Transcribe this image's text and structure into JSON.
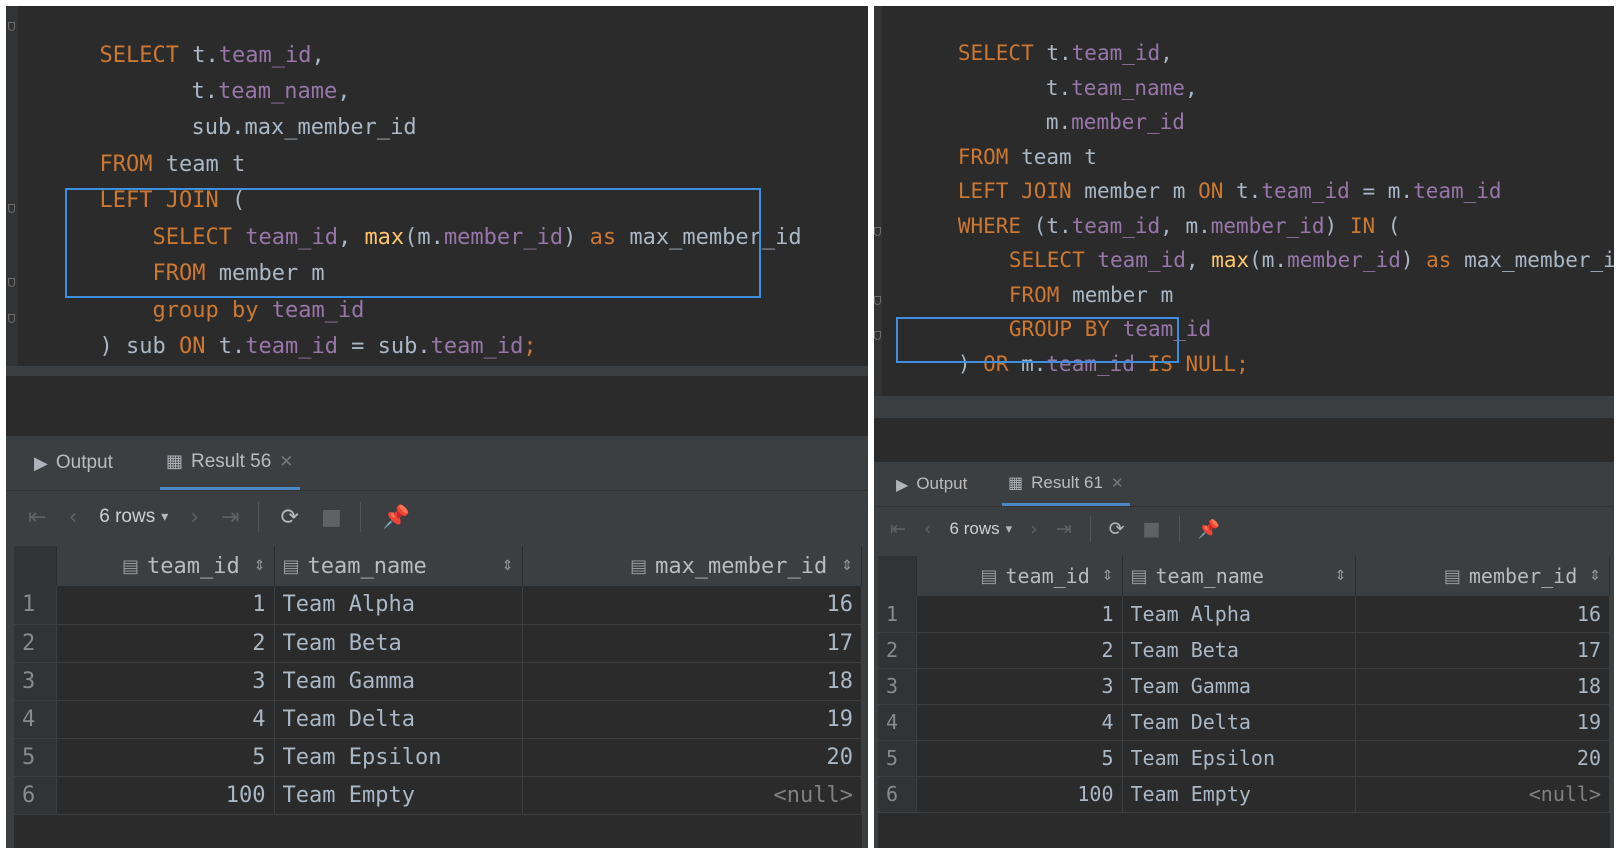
{
  "colors": {
    "keyword": "#cc7832",
    "field": "#9876aa",
    "function": "#ffc66d",
    "text": "#a9b7c6",
    "highlight": "#3d8fe0"
  },
  "left": {
    "code": {
      "l1": [
        "SELECT",
        " t.",
        "team_id",
        ","
      ],
      "l2": [
        "t.",
        "team_name",
        ","
      ],
      "l3": [
        "sub.max_member_id"
      ],
      "l4": [
        "FROM",
        " team t"
      ],
      "l5": [
        "LEFT JOIN",
        " ("
      ],
      "l6": [
        "SELECT",
        " ",
        "team_id",
        ", ",
        "max",
        "(m.",
        "member_id",
        ") ",
        "as",
        " max_member_id"
      ],
      "l7": [
        "FROM",
        " member m"
      ],
      "l8": [
        "group by",
        " ",
        "team_id"
      ],
      "l9": [
        ") sub ",
        "ON",
        " t.",
        "team_id",
        " = sub.",
        "team_id",
        ";"
      ]
    },
    "tabs": {
      "output": "Output",
      "result": "Result 56"
    },
    "rows_label": "6 rows",
    "columns": [
      "team_id",
      "team_name",
      "max_member_id"
    ],
    "rows": [
      {
        "n": "1",
        "team_id": "1",
        "team_name": "Team Alpha",
        "value": "16"
      },
      {
        "n": "2",
        "team_id": "2",
        "team_name": "Team Beta",
        "value": "17"
      },
      {
        "n": "3",
        "team_id": "3",
        "team_name": "Team Gamma",
        "value": "18"
      },
      {
        "n": "4",
        "team_id": "4",
        "team_name": "Team Delta",
        "value": "19"
      },
      {
        "n": "5",
        "team_id": "5",
        "team_name": "Team Epsilon",
        "value": "20"
      },
      {
        "n": "6",
        "team_id": "100",
        "team_name": "Team Empty",
        "value": "<null>"
      }
    ]
  },
  "right": {
    "code": {
      "l1": [
        "SELECT",
        " t.",
        "team_id",
        ","
      ],
      "l2": [
        "t.",
        "team_name",
        ","
      ],
      "l3": [
        "m.",
        "member_id"
      ],
      "l4": [
        "FROM",
        " team t"
      ],
      "l5": [
        "LEFT JOIN",
        " member m ",
        "ON",
        " t.",
        "team_id",
        " = m.",
        "team_id"
      ],
      "l6": [
        "WHERE",
        " (t.",
        "team_id",
        ", m.",
        "member_id",
        ") ",
        "IN",
        " ("
      ],
      "l7": [
        "SELECT",
        " ",
        "team_id",
        ", ",
        "max",
        "(m.",
        "member_id",
        ") ",
        "as",
        " max_member_id"
      ],
      "l8": [
        "FROM",
        " member m"
      ],
      "l9": [
        "GROUP BY",
        " ",
        "team_id"
      ],
      "l10": [
        ")",
        " ",
        "OR",
        " m.",
        "team_id",
        " ",
        "IS NULL",
        ";"
      ]
    },
    "tabs": {
      "output": "Output",
      "result": "Result 61"
    },
    "rows_label": "6 rows",
    "columns": [
      "team_id",
      "team_name",
      "member_id"
    ],
    "rows": [
      {
        "n": "1",
        "team_id": "1",
        "team_name": "Team Alpha",
        "value": "16"
      },
      {
        "n": "2",
        "team_id": "2",
        "team_name": "Team Beta",
        "value": "17"
      },
      {
        "n": "3",
        "team_id": "3",
        "team_name": "Team Gamma",
        "value": "18"
      },
      {
        "n": "4",
        "team_id": "4",
        "team_name": "Team Delta",
        "value": "19"
      },
      {
        "n": "5",
        "team_id": "5",
        "team_name": "Team Epsilon",
        "value": "20"
      },
      {
        "n": "6",
        "team_id": "100",
        "team_name": "Team Empty",
        "value": "<null>"
      }
    ]
  }
}
